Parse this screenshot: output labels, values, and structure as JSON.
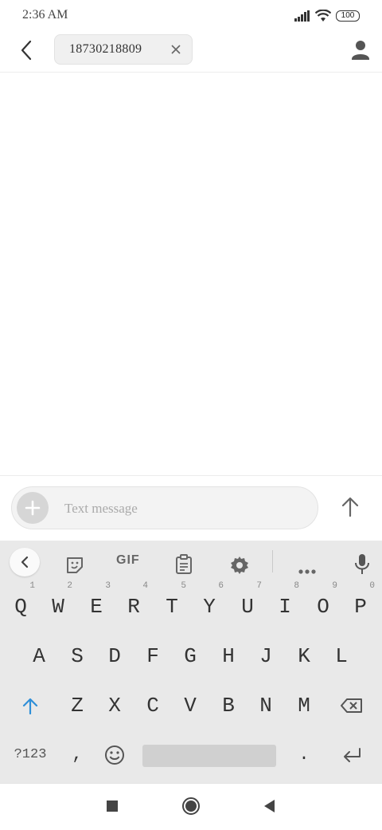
{
  "status_bar": {
    "time": "2:36 AM",
    "battery": "100"
  },
  "header": {
    "recipient": "18730218809"
  },
  "compose": {
    "placeholder": "Text message"
  },
  "keyboard": {
    "toolbar": {
      "gif_label": "GIF"
    },
    "row1": [
      {
        "key": "Q",
        "hint": "1"
      },
      {
        "key": "W",
        "hint": "2"
      },
      {
        "key": "E",
        "hint": "3"
      },
      {
        "key": "R",
        "hint": "4"
      },
      {
        "key": "T",
        "hint": "5"
      },
      {
        "key": "Y",
        "hint": "6"
      },
      {
        "key": "U",
        "hint": "7"
      },
      {
        "key": "I",
        "hint": "8"
      },
      {
        "key": "O",
        "hint": "9"
      },
      {
        "key": "P",
        "hint": "0"
      }
    ],
    "row2": [
      "A",
      "S",
      "D",
      "F",
      "G",
      "H",
      "J",
      "K",
      "L"
    ],
    "row3": [
      "Z",
      "X",
      "C",
      "V",
      "B",
      "N",
      "M"
    ],
    "bottom": {
      "symbols": "?123",
      "comma": ",",
      "period": "."
    }
  },
  "colors": {
    "shift_accent": "#2f8fd8",
    "keyboard_bg": "#e9e9e9"
  }
}
